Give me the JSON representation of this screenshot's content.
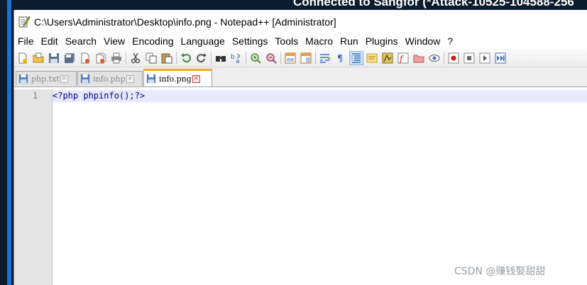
{
  "remote": {
    "title": "Connected to Sangfor (*Attack-10525-104588-256"
  },
  "window": {
    "title": "C:\\Users\\Administrator\\Desktop\\info.png - Notepad++ [Administrator]"
  },
  "menu": {
    "items": [
      "File",
      "Edit",
      "Search",
      "View",
      "Encoding",
      "Language",
      "Settings",
      "Tools",
      "Macro",
      "Run",
      "Plugins",
      "Window",
      "?"
    ]
  },
  "toolbar": {
    "icons": [
      "new-file-icon",
      "open-file-icon",
      "save-icon",
      "save-all-icon",
      "close-icon",
      "close-all-icon",
      "print-icon",
      "cut-icon",
      "copy-icon",
      "paste-icon",
      "undo-icon",
      "redo-icon",
      "find-icon",
      "replace-icon",
      "zoom-in-icon",
      "zoom-out-icon",
      "sync-vertical-icon",
      "sync-horizontal-icon",
      "word-wrap-icon",
      "show-all-chars-icon",
      "indent-guide-icon",
      "user-language-icon",
      "doc-map-icon",
      "function-list-icon",
      "folder-as-workspace-icon",
      "monitoring-icon",
      "record-macro-icon",
      "stop-macro-icon",
      "play-macro-icon",
      "run-macro-multiple-icon"
    ]
  },
  "tabs": [
    {
      "label": "php.txt",
      "active": false
    },
    {
      "label": "info.php",
      "active": false
    },
    {
      "label": "info.png",
      "active": true
    }
  ],
  "editor": {
    "line_number": "1",
    "code": "<?php phpinfo();?>"
  },
  "watermark": {
    "text": "CSDN @赚钱娶甜甜"
  },
  "colors": {
    "active_tab_accent": "#f5a623",
    "current_line_highlight": "#e8e8ff",
    "code_text": "#000080",
    "remote_bar": "#0d1c2d",
    "remote_edge_blue": "#1e6fd1"
  }
}
